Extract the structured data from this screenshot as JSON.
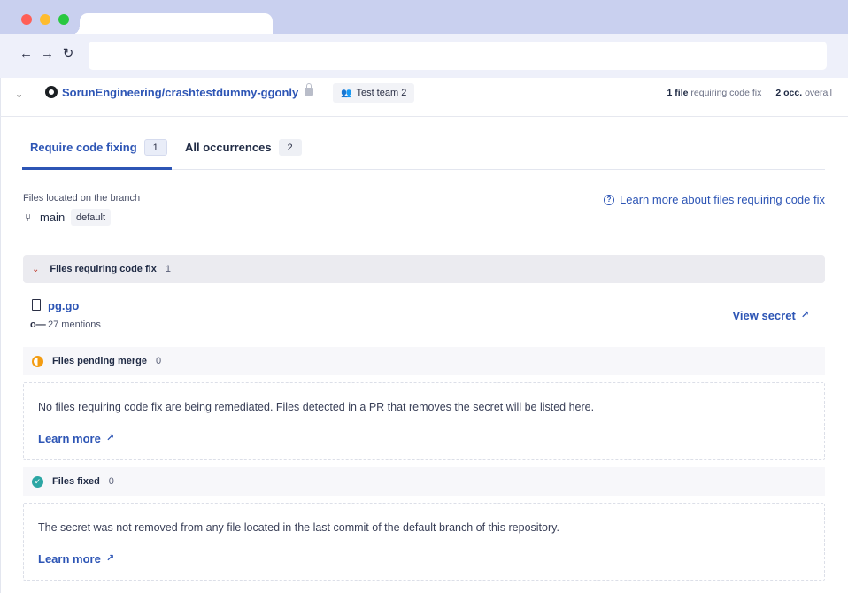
{
  "repo": {
    "name": "SorunEngineering/crashtestdummy-ggonly",
    "team": "Test team 2",
    "stats": {
      "files_count": "1 file",
      "files_label": "requiring code fix",
      "occ_count": "2 occ.",
      "occ_label": "overall"
    }
  },
  "tabs": [
    {
      "label": "Require code fixing",
      "count": "1"
    },
    {
      "label": "All occurrences",
      "count": "2"
    }
  ],
  "branch": {
    "label": "Files located on the branch",
    "name": "main",
    "tag": "default"
  },
  "help_link": "Learn more about files requiring code fix",
  "sections": {
    "requiring": {
      "title": "Files requiring code fix",
      "count": "1",
      "file": {
        "name": "pg.go",
        "mentions": "27 mentions",
        "action": "View secret"
      }
    },
    "pending": {
      "title": "Files pending merge",
      "count": "0",
      "message": "No files requiring code fix are being remediated. Files detected in a PR that removes the secret will be listed here.",
      "link": "Learn more"
    },
    "fixed": {
      "title": "Files fixed",
      "count": "0",
      "message": "The secret was not removed from any file located in the last commit of the default branch of this repository.",
      "link": "Learn more"
    }
  },
  "colors": {
    "link": "#2d55b5",
    "pending": "#f39c12",
    "fixed": "#2ca6a4",
    "chrome": "#c9d0ef"
  }
}
